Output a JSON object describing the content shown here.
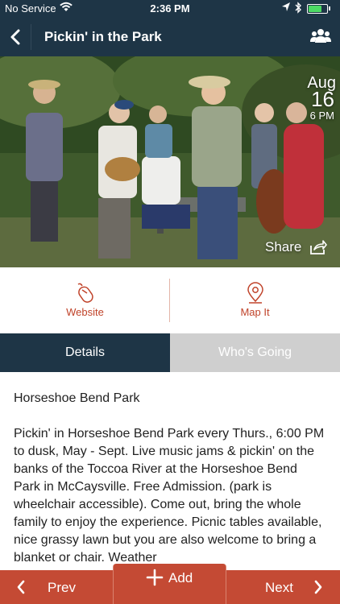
{
  "status_bar": {
    "carrier": "No Service",
    "time": "2:36 PM",
    "battery_color": "#4cd964"
  },
  "nav": {
    "title": "Pickin' in the Park",
    "back_icon": "chevron-left-icon",
    "group_icon": "people-icon"
  },
  "event": {
    "month": "Aug",
    "day": "16",
    "time": "6 PM",
    "share_label": "Share"
  },
  "actions": [
    {
      "label": "Website",
      "icon": "mouse-icon"
    },
    {
      "label": "Map It",
      "icon": "map-pin-icon"
    }
  ],
  "tabs": {
    "details": "Details",
    "whos_going": "Who's Going"
  },
  "details": {
    "venue": "Horseshoe Bend Park",
    "description": "Pickin' in Horseshoe Bend Park every Thurs., 6:00 PM to dusk, May - Sept. Live music jams & pickin' on the banks of the Toccoa River at the Horseshoe Bend Park in McCaysville. Free Admission. (park is wheelchair accessible). Come out, bring the whole family to enjoy the experience. Picnic tables available, nice grassy lawn but you are also welcome to bring a blanket or chair. Weather"
  },
  "bottom_bar": {
    "prev": "Prev",
    "add": "Add",
    "next": "Next"
  },
  "colors": {
    "navy": "#1e3546",
    "accent": "#c44a34",
    "tab_inactive": "#cfcfcf"
  }
}
